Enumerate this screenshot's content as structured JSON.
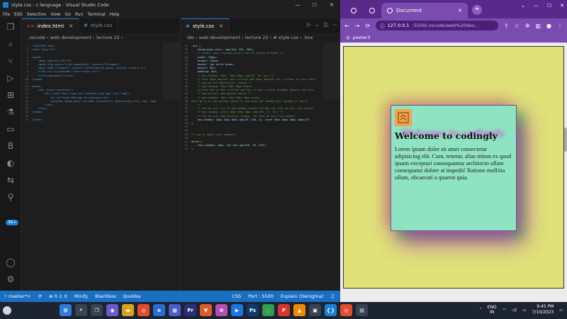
{
  "vscode": {
    "title": "style.css - c language - Visual Studio Code",
    "menu": [
      "File",
      "Edit",
      "Selection",
      "View",
      "Go",
      "Run",
      "Terminal",
      "Help"
    ],
    "activity_badge": "3K+",
    "left_editor": {
      "tabs": [
        {
          "label": "index.html",
          "active": true
        },
        {
          "label": "style.css",
          "active": false
        }
      ],
      "breadcrumb": ".vscode › web development › lecture 22 ›",
      "lines": [
        {
          "n": "1",
          "t": "<!DOCTYPE html>",
          "k": "tag"
        },
        {
          "n": "2",
          "t": "<html lang=\"en\">",
          "k": "tag"
        },
        {
          "n": "3",
          "t": "",
          "k": ""
        },
        {
          "n": "4",
          "t": "<head>",
          "k": "tag"
        },
        {
          "n": "5",
          "t": "    <meta charset=\"UTF-8\">",
          "k": "tag"
        },
        {
          "n": "6",
          "t": "    <meta http-equiv=\"X-UA-Compatible\" content=\"IE=edge\">",
          "k": "tag"
        },
        {
          "n": "7",
          "t": "    <meta name=\"viewport\" content=\"width=device-width, initial-scale=1.0\">",
          "k": "tag"
        },
        {
          "n": "8",
          "t": "    <link rel=\"stylesheet\" href=\"style.css\">",
          "k": "tag"
        },
        {
          "n": "9",
          "t": "    <title>Document</title>",
          "k": "tag"
        },
        {
          "n": "10",
          "t": "</head>",
          "k": "tag"
        },
        {
          "n": "11",
          "t": "",
          "k": ""
        },
        {
          "n": "12",
          "t": "<body>",
          "k": "tag"
        },
        {
          "n": "13",
          "t": "    <div class=\"container\">",
          "k": "tag"
        },
        {
          "n": "14",
          "t": "        <div class=\"box\"><img src=\"codingly.png.jpg\" alt=\"logo\">",
          "k": "tag"
        },
        {
          "n": "15",
          "t": "            <h2 id=\"head\">Welcome to Codingly</h2>",
          "k": "tag"
        },
        {
          "n": "16",
          "t": "            <p>Lorem ipsum dolor sit amet consectetur adipisicing elit. Cum, tene",
          "k": "tag"
        },
        {
          "n": "17",
          "t": "        </div>",
          "k": "tag"
        },
        {
          "n": "18",
          "t": "    </div>",
          "k": "tag"
        },
        {
          "n": "19",
          "t": "</body>",
          "k": "tag"
        },
        {
          "n": "20",
          "t": "",
          "k": ""
        },
        {
          "n": "21",
          "t": "</html>",
          "k": "tag"
        }
      ]
    },
    "right_editor": {
      "tabs": [
        {
          "label": "style.css",
          "active": true
        }
      ],
      "breadcrumb": "ide › web development › lecture 22 › # style.css › .box",
      "lines": [
        {
          "n": "25",
          "t": ".box {",
          "k": "sel"
        },
        {
          "n": "26",
          "t": "    background-color: rgb(144, 231, 200);",
          "k": "at"
        },
        {
          "n": "27",
          "t": "    /* width: var(--custom-color); use of custom variable */",
          "k": "cm"
        },
        {
          "n": "28",
          "t": "    width: 230px;",
          "k": "at"
        },
        {
          "n": "29",
          "t": "    height: 230px;",
          "k": "at"
        },
        {
          "n": "30",
          "t": "    border: 1px solid brown;",
          "k": "at"
        },
        {
          "n": "31",
          "t": "    margin: 9px;",
          "k": "at"
        },
        {
          "n": "32",
          "t": "    padding: 9px;",
          "k": "at"
        },
        {
          "n": "33",
          "t": "    /* box-shadow: 10px -10px 30px rgb(23, 10, 10); */",
          "k": "cm"
        },
        {
          "n": "34",
          "t": "    /* here 10px denotes the x offset and 10px denotes the y offset it just simil",
          "k": "cm"
        },
        {
          "n": "35",
          "t": "    /* now we are adding blur radius */",
          "k": "cm"
        },
        {
          "n": "36",
          "t": "    /* box-shadow: 10px 15px 30px black;",
          "k": "cm"
        },
        {
          "n": "37",
          "t": "    in here 1px is the x offset and 1px is the y offset and30px denotes the blur",
          "k": "cm"
        },
        {
          "n": "38",
          "t": "    /* now we will add spread radius */",
          "k": "cm"
        },
        {
          "n": "39",
          "t": "    /* box-shadow: 10px 15px 30px 40px brown;",
          "k": "cm"
        },
        {
          "n": "40",
          "t": "here 40 in is the spread radius in how much the shadow will spread in the st",
          "k": "cm"
        },
        {
          "n": "41",
          "t": "    */",
          "k": "cm"
        },
        {
          "n": "42",
          "t": "    /* now we will try to add shadow inside the box for that we will use inset*/",
          "k": "cm"
        },
        {
          "n": "43",
          "t": "    /* box-shadow: inset 10px 15px 30px rgb(170, 17, 37); */",
          "k": "cm"
        },
        {
          "n": "44",
          "t": "    /* now we will add multiple shadow  for that we will use comma*/",
          "k": "cm"
        },
        {
          "n": "45",
          "t": "    box-shadow: 10px 15px 30px rgb(16, 128, 4), inset 15px 10px 40px rgba(171",
          "k": "at"
        },
        {
          "n": "46",
          "t": "}",
          "k": "sel"
        },
        {
          "n": "47",
          "t": "",
          "k": ""
        },
        {
          "n": "48",
          "t": "",
          "k": ""
        },
        {
          "n": "49",
          "t": "/* how to apply text shadow*/",
          "k": "cm"
        },
        {
          "n": "50",
          "t": "",
          "k": ""
        },
        {
          "n": "51",
          "t": "#head {",
          "k": "sel"
        },
        {
          "n": "52",
          "t": "    text-shadow: 10px -7px 5px rgb(216, 95, 233);",
          "k": "at"
        },
        {
          "n": "53",
          "t": "}",
          "k": "sel"
        }
      ]
    },
    "status": {
      "branch": "master*+",
      "problems": "⊗ 0 ⚠ 0",
      "minify": "Minify",
      "blackbox": "Blackbox",
      "quokka": "Quokka",
      "language": "CSS",
      "port": "Port : 5500",
      "explain": "Explain (Denigma)"
    }
  },
  "browser": {
    "tab_label": "Document",
    "url_host": "127.0.0.1",
    "url_path": ":5500/.vscode/web%20dev...",
    "bookmark": "poster3",
    "page": {
      "heading": "Welcome to codingly",
      "paragraph": "Lorem ipsum dolor sit amet consectetur adipisicing elit. Cum, tenetur, alias minus ex quod ipsum excepturi consequuntur architecto ullam consequatur dolore at impedit! Ratione mollitia ullam, obcaecati a quaerat quia."
    }
  },
  "taskbar": {
    "lang_top": "ENG",
    "lang_bottom": "IN",
    "time": "9:45 PM",
    "date": "7/10/2023"
  }
}
